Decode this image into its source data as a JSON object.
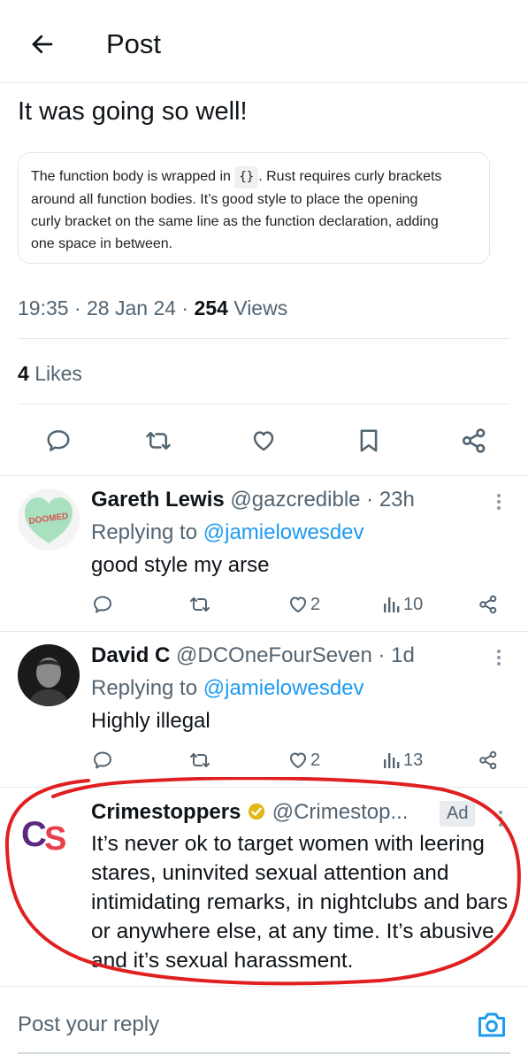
{
  "header": {
    "title": "Post"
  },
  "post": {
    "text": "It was going so well!",
    "card": {
      "line1_pre": "The function body is wrapped in",
      "line1_code": "{}",
      "line1_post": ". Rust requires curly brackets",
      "line2": "around all function bodies. It’s good style to place the opening",
      "line3": "curly bracket on the same line as the function declaration, adding",
      "line4": "one space in between."
    },
    "time": "19:35",
    "date": "28 Jan 24",
    "views_count": "254",
    "views_label": "Views",
    "likes_count": "4",
    "likes_label": "Likes",
    "actions": [
      "reply-icon",
      "repost-icon",
      "like-icon",
      "bookmark-icon",
      "share-icon"
    ]
  },
  "replies": [
    {
      "name": "Gareth Lewis",
      "handle": "@gazcredible",
      "age": "23h",
      "replying_prefix": "Replying to",
      "replying_to": "@jamielowesdev",
      "text": "good style my arse",
      "avatar_text": "DOOMED",
      "likes": "2",
      "views": "10"
    },
    {
      "name": "David C",
      "handle": "@DCOneFourSeven",
      "age": "1d",
      "replying_prefix": "Replying to",
      "replying_to": "@jamielowesdev",
      "text": "Highly illegal",
      "likes": "2",
      "views": "13"
    }
  ],
  "ad": {
    "name": "Crimestoppers",
    "handle": "@Crimestop...",
    "badge": "Ad",
    "logo_text": "CS",
    "text": "It’s never ok to target women with leering stares, uninvited sexual attention and intimidating remarks, in nightclubs and bars or anywhere else, at any time. It’s abusive and it’s sexual harassment."
  },
  "reply_box": {
    "placeholder": "Post your reply"
  },
  "colors": {
    "link": "#1d9bf0",
    "secondary": "#536471",
    "highlight": "#e02020",
    "verified": "#e2b719"
  }
}
